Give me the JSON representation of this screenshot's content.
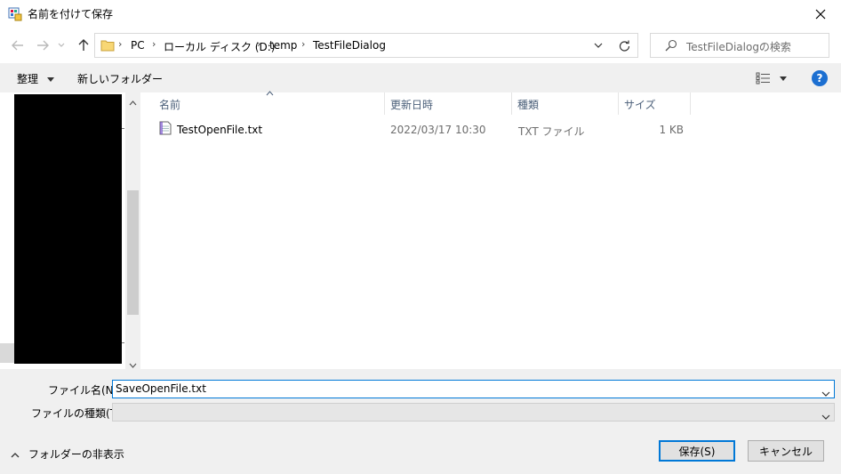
{
  "window": {
    "title": "名前を付けて保存",
    "close": "✕"
  },
  "nav": {
    "crumbs": [
      "PC",
      "ローカル ディスク (D:)",
      "temp",
      "TestFileDialog"
    ],
    "search_placeholder": "TestFileDialogの検索"
  },
  "toolbar": {
    "organize": "整理",
    "new_folder": "新しいフォルダー",
    "help": "?"
  },
  "columns": {
    "name": "名前",
    "modified": "更新日時",
    "type": "種類",
    "size": "サイズ"
  },
  "files": [
    {
      "name": "TestOpenFile.txt",
      "modified": "2022/03/17 10:30",
      "type": "TXT ファイル",
      "size": "1 KB"
    }
  ],
  "bottom": {
    "filename_label": "ファイル名(N):",
    "filename_value": "SaveOpenFile.txt",
    "filetype_label": "ファイルの種類(T):",
    "filetype_value": "",
    "hide_folders": "フォルダーの非表示",
    "save": "保存(S)",
    "cancel": "キャンセル"
  }
}
